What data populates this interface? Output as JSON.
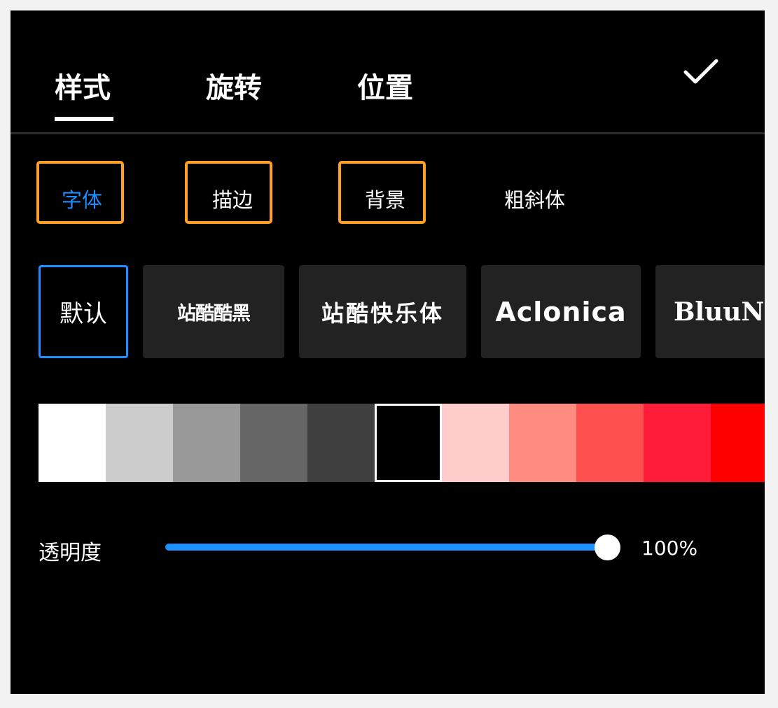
{
  "tabs": [
    {
      "label": "样式"
    },
    {
      "label": "旋转"
    },
    {
      "label": "位置"
    }
  ],
  "confirm_icon": "checkmark-icon",
  "subtabs": [
    {
      "label": "字体"
    },
    {
      "label": "描边"
    },
    {
      "label": "背景"
    },
    {
      "label": "粗斜体"
    }
  ],
  "fonts": [
    {
      "label": "默认"
    },
    {
      "label": "站酷酷黑"
    },
    {
      "label": "站酷快乐体"
    },
    {
      "label": "Aclonica"
    },
    {
      "label": "BluuNext"
    }
  ],
  "colors": [
    "#ffffff",
    "#cccccc",
    "#999999",
    "#666666",
    "#404040",
    "#000000",
    "#ffcccc",
    "#ff8c80",
    "#ff5050",
    "#ff1c38",
    "#ff0000"
  ],
  "accent_color": "#1e8fff",
  "highlight_color": "#ffa024",
  "opacity": {
    "label": "透明度",
    "value_text": "100%",
    "value": 1.0
  }
}
